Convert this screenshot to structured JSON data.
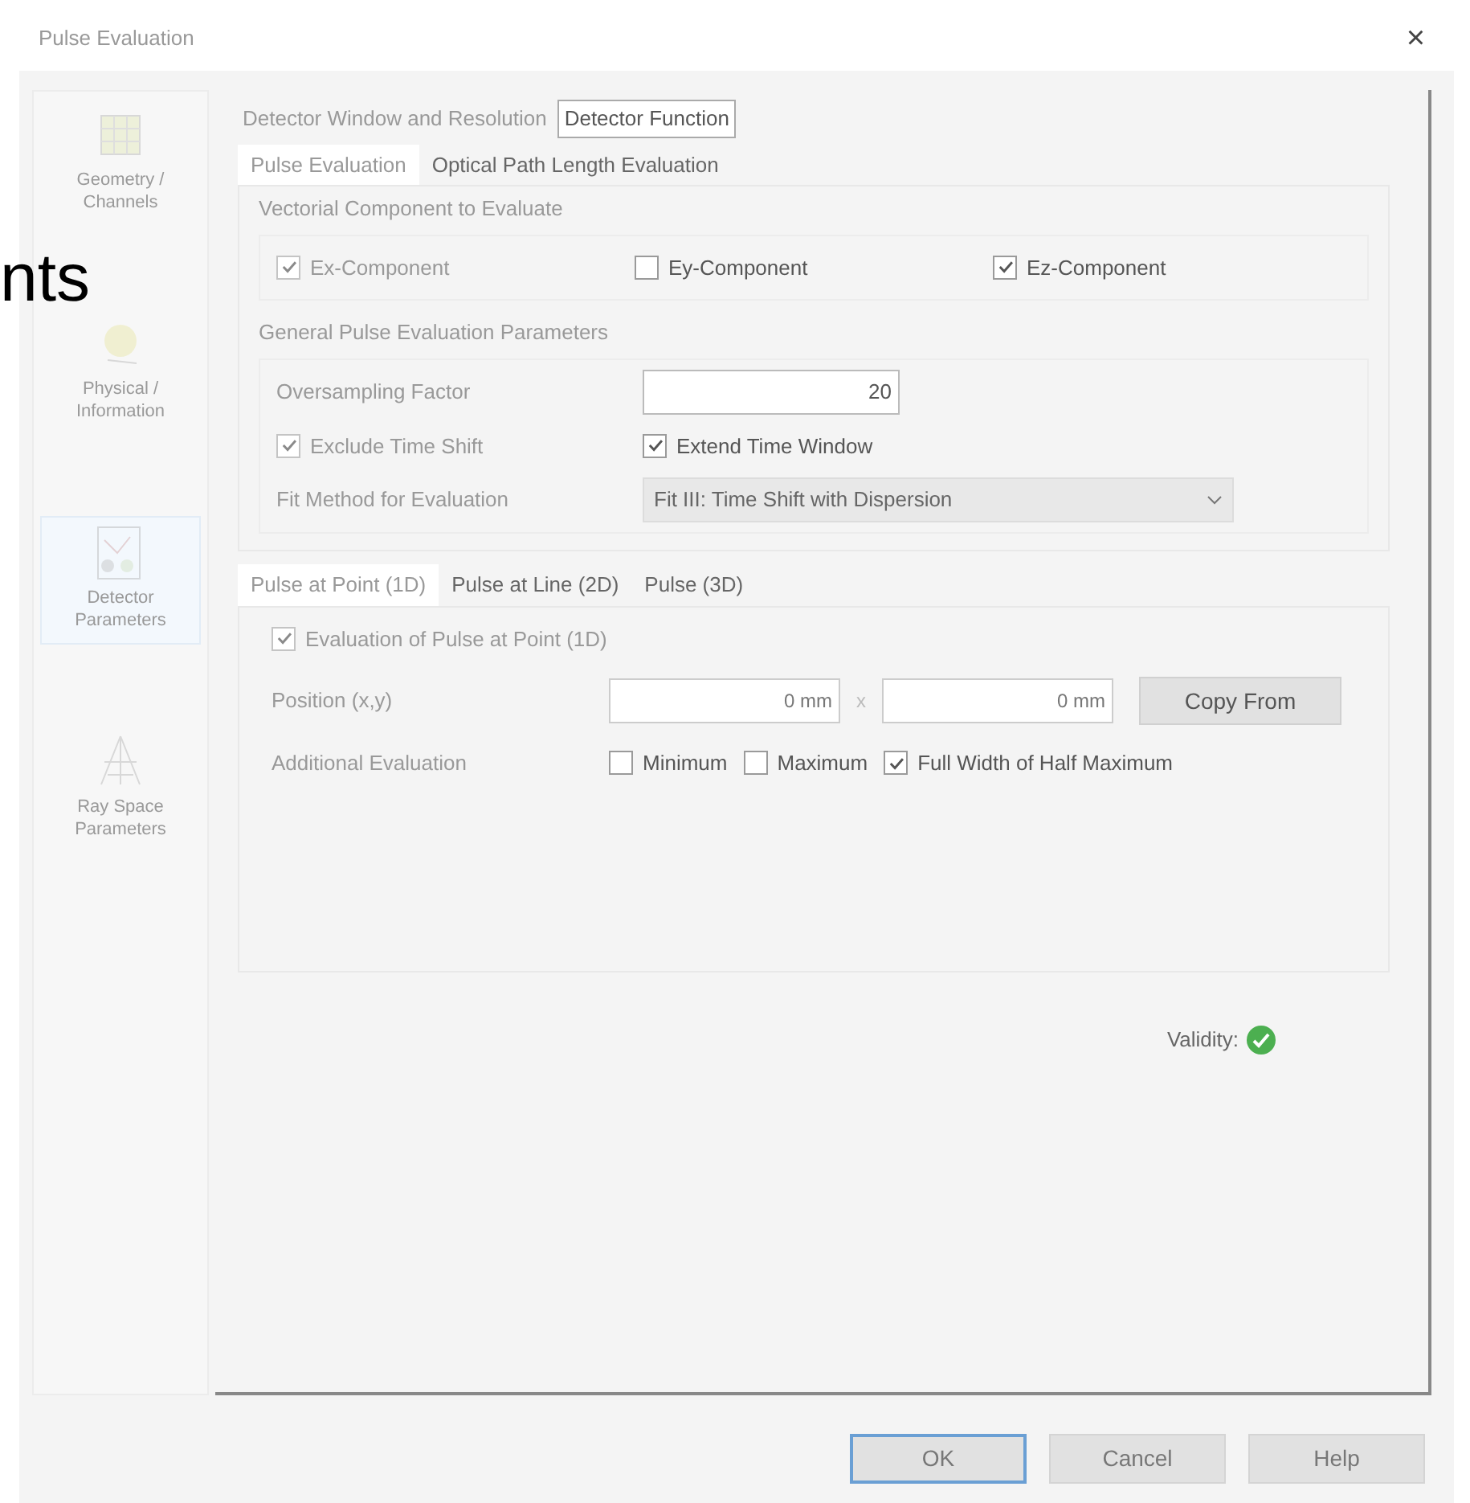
{
  "overlay_text": "nts",
  "window": {
    "title": "Pulse Evaluation",
    "close": "×"
  },
  "sidebar": {
    "items": [
      {
        "label": "Geometry / Channels",
        "selected": false,
        "kind": "geometry"
      },
      {
        "label": "Physical / Information",
        "selected": false,
        "kind": "physical"
      },
      {
        "label": "Detector Parameters",
        "selected": true,
        "kind": "detector"
      },
      {
        "label": "Ray Space Parameters",
        "selected": false,
        "kind": "rays"
      }
    ]
  },
  "outer_tabs": [
    {
      "label": "Detector Window and Resolution",
      "selected": false
    },
    {
      "label": "Detector Function",
      "selected": true
    }
  ],
  "inner_tabs": [
    {
      "label": "Pulse Evaluation",
      "selected": true
    },
    {
      "label": "Optical Path Length Evaluation",
      "selected": false
    }
  ],
  "vectorial_group": {
    "title": "Vectorial Component to Evaluate",
    "checkboxes": [
      {
        "label": "Ex-Component",
        "checked": true,
        "disabled": true
      },
      {
        "label": "Ey-Component",
        "checked": false,
        "disabled": false
      },
      {
        "label": "Ez-Component",
        "checked": true,
        "disabled": false
      }
    ]
  },
  "general_group": {
    "title": "General Pulse Evaluation Parameters",
    "oversampling": {
      "label": "Oversampling Factor",
      "value": "20"
    },
    "checkboxes": [
      {
        "label": "Exclude Time Shift",
        "checked": true,
        "disabled": true
      },
      {
        "label": "Extend Time Window",
        "checked": true,
        "disabled": false
      }
    ],
    "fit_method": {
      "label": "Fit Method for Evaluation",
      "value": "Fit III: Time Shift with Dispersion"
    }
  },
  "point_tabs": [
    {
      "label": "Pulse at Point (1D)",
      "selected": true
    },
    {
      "label": "Pulse at Line (2D)",
      "selected": false
    },
    {
      "label": "Pulse (3D)",
      "selected": false
    }
  ],
  "point_panel": {
    "evaluation": {
      "label": "Evaluation of Pulse at Point (1D)",
      "checked": true,
      "disabled": true
    },
    "position": {
      "label": "Position (x,y)",
      "x": "0 mm",
      "separator": "x",
      "y": "0 mm",
      "button": "Copy From"
    },
    "additional": {
      "label": "Additional Evaluation",
      "checkboxes": [
        {
          "label": "Minimum",
          "checked": false,
          "disabled": false
        },
        {
          "label": "Maximum",
          "checked": false,
          "disabled": false
        },
        {
          "label": "Full Width of Half Maximum",
          "checked": true,
          "disabled": false
        }
      ]
    }
  },
  "validity": {
    "label": "Validity:",
    "valid": true
  },
  "buttons": [
    {
      "label": "OK",
      "default": true
    },
    {
      "label": "Cancel",
      "default": false
    },
    {
      "label": "Help",
      "default": false
    }
  ]
}
